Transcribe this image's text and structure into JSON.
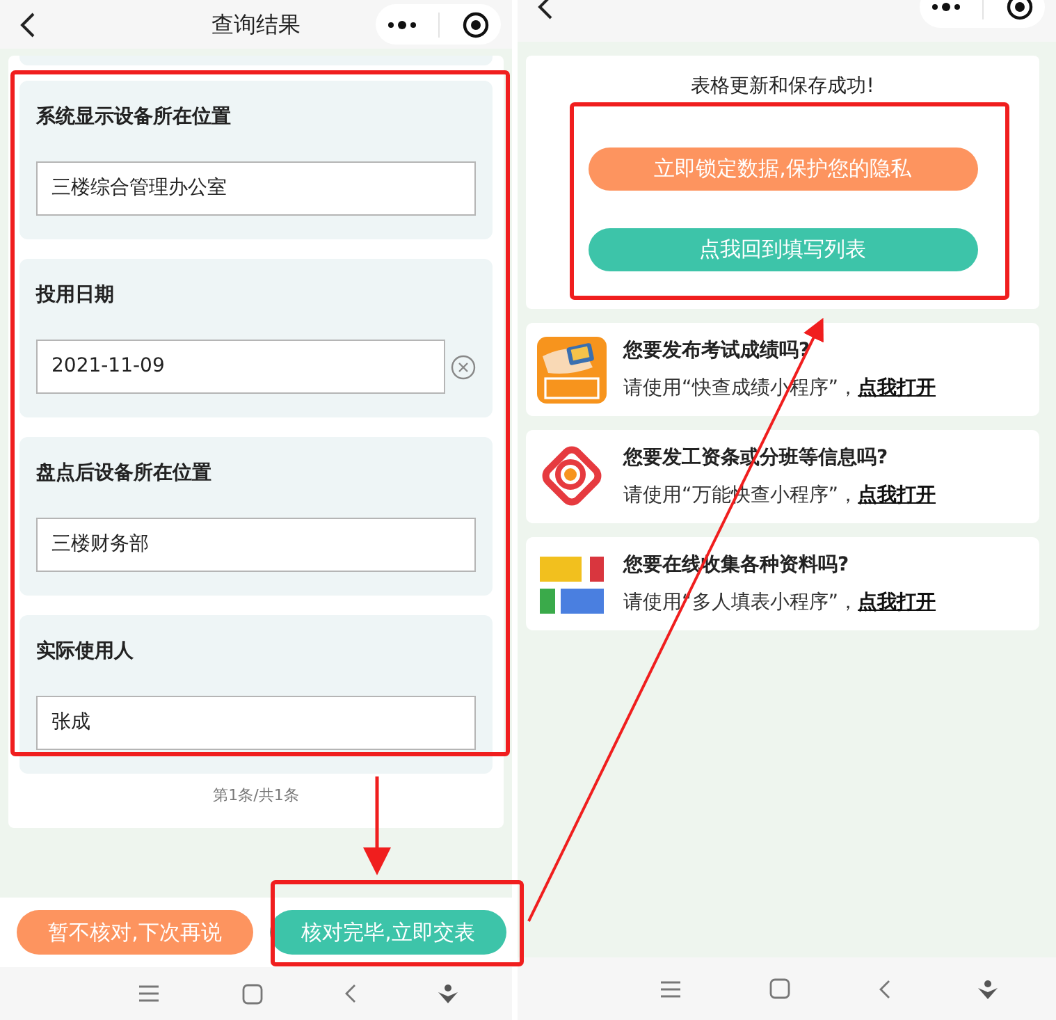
{
  "left_screen": {
    "title": "查询结果",
    "fields": [
      {
        "label": "系统显示设备所在位置",
        "value": "三楼综合管理办公室",
        "clearable": false
      },
      {
        "label": "投用日期",
        "value": "2021-11-09",
        "clearable": true
      },
      {
        "label": "盘点后设备所在位置",
        "value": "三楼财务部",
        "clearable": false
      },
      {
        "label": "实际使用人",
        "value": "张成",
        "clearable": false
      }
    ],
    "pager": "第1条/共1条",
    "buttons": [
      {
        "label": "暂不核对,下次再说",
        "kind": "orange"
      },
      {
        "label": "核对完毕,立即交表",
        "kind": "teal"
      }
    ]
  },
  "right_screen": {
    "message": "表格更新和保存成功!",
    "buttons": [
      {
        "label": "立即锁定数据,保护您的隐私",
        "kind": "orange"
      },
      {
        "label": "点我回到填写列表",
        "kind": "teal"
      }
    ],
    "promos": [
      {
        "kind": "score",
        "title": "您要发布考试成绩吗?",
        "text": "请使用“快查成绩小程序”，",
        "link": "点我打开"
      },
      {
        "kind": "search",
        "title": "您要发工资条或分班等信息吗?",
        "text": "请使用“万能快查小程序”，",
        "link": "点我打开"
      },
      {
        "kind": "blocks",
        "title": "您要在线收集各种资料吗?",
        "text": "请使用“多人填表小程序”，",
        "link": "点我打开"
      }
    ]
  }
}
